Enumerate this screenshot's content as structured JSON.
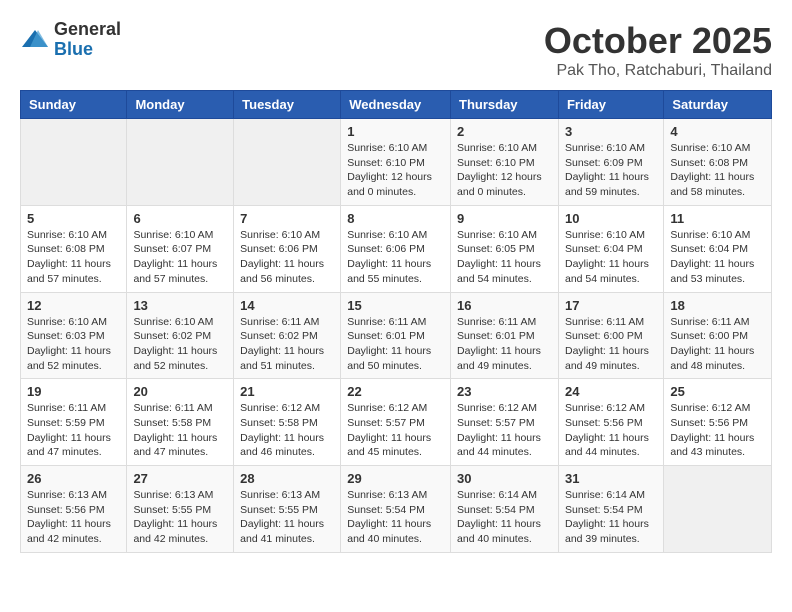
{
  "header": {
    "logo_general": "General",
    "logo_blue": "Blue",
    "month_title": "October 2025",
    "location": "Pak Tho, Ratchaburi, Thailand"
  },
  "weekdays": [
    "Sunday",
    "Monday",
    "Tuesday",
    "Wednesday",
    "Thursday",
    "Friday",
    "Saturday"
  ],
  "weeks": [
    [
      {
        "day": "",
        "info": ""
      },
      {
        "day": "",
        "info": ""
      },
      {
        "day": "",
        "info": ""
      },
      {
        "day": "1",
        "info": "Sunrise: 6:10 AM\nSunset: 6:10 PM\nDaylight: 12 hours\nand 0 minutes."
      },
      {
        "day": "2",
        "info": "Sunrise: 6:10 AM\nSunset: 6:10 PM\nDaylight: 12 hours\nand 0 minutes."
      },
      {
        "day": "3",
        "info": "Sunrise: 6:10 AM\nSunset: 6:09 PM\nDaylight: 11 hours\nand 59 minutes."
      },
      {
        "day": "4",
        "info": "Sunrise: 6:10 AM\nSunset: 6:08 PM\nDaylight: 11 hours\nand 58 minutes."
      }
    ],
    [
      {
        "day": "5",
        "info": "Sunrise: 6:10 AM\nSunset: 6:08 PM\nDaylight: 11 hours\nand 57 minutes."
      },
      {
        "day": "6",
        "info": "Sunrise: 6:10 AM\nSunset: 6:07 PM\nDaylight: 11 hours\nand 57 minutes."
      },
      {
        "day": "7",
        "info": "Sunrise: 6:10 AM\nSunset: 6:06 PM\nDaylight: 11 hours\nand 56 minutes."
      },
      {
        "day": "8",
        "info": "Sunrise: 6:10 AM\nSunset: 6:06 PM\nDaylight: 11 hours\nand 55 minutes."
      },
      {
        "day": "9",
        "info": "Sunrise: 6:10 AM\nSunset: 6:05 PM\nDaylight: 11 hours\nand 54 minutes."
      },
      {
        "day": "10",
        "info": "Sunrise: 6:10 AM\nSunset: 6:04 PM\nDaylight: 11 hours\nand 54 minutes."
      },
      {
        "day": "11",
        "info": "Sunrise: 6:10 AM\nSunset: 6:04 PM\nDaylight: 11 hours\nand 53 minutes."
      }
    ],
    [
      {
        "day": "12",
        "info": "Sunrise: 6:10 AM\nSunset: 6:03 PM\nDaylight: 11 hours\nand 52 minutes."
      },
      {
        "day": "13",
        "info": "Sunrise: 6:10 AM\nSunset: 6:02 PM\nDaylight: 11 hours\nand 52 minutes."
      },
      {
        "day": "14",
        "info": "Sunrise: 6:11 AM\nSunset: 6:02 PM\nDaylight: 11 hours\nand 51 minutes."
      },
      {
        "day": "15",
        "info": "Sunrise: 6:11 AM\nSunset: 6:01 PM\nDaylight: 11 hours\nand 50 minutes."
      },
      {
        "day": "16",
        "info": "Sunrise: 6:11 AM\nSunset: 6:01 PM\nDaylight: 11 hours\nand 49 minutes."
      },
      {
        "day": "17",
        "info": "Sunrise: 6:11 AM\nSunset: 6:00 PM\nDaylight: 11 hours\nand 49 minutes."
      },
      {
        "day": "18",
        "info": "Sunrise: 6:11 AM\nSunset: 6:00 PM\nDaylight: 11 hours\nand 48 minutes."
      }
    ],
    [
      {
        "day": "19",
        "info": "Sunrise: 6:11 AM\nSunset: 5:59 PM\nDaylight: 11 hours\nand 47 minutes."
      },
      {
        "day": "20",
        "info": "Sunrise: 6:11 AM\nSunset: 5:58 PM\nDaylight: 11 hours\nand 47 minutes."
      },
      {
        "day": "21",
        "info": "Sunrise: 6:12 AM\nSunset: 5:58 PM\nDaylight: 11 hours\nand 46 minutes."
      },
      {
        "day": "22",
        "info": "Sunrise: 6:12 AM\nSunset: 5:57 PM\nDaylight: 11 hours\nand 45 minutes."
      },
      {
        "day": "23",
        "info": "Sunrise: 6:12 AM\nSunset: 5:57 PM\nDaylight: 11 hours\nand 44 minutes."
      },
      {
        "day": "24",
        "info": "Sunrise: 6:12 AM\nSunset: 5:56 PM\nDaylight: 11 hours\nand 44 minutes."
      },
      {
        "day": "25",
        "info": "Sunrise: 6:12 AM\nSunset: 5:56 PM\nDaylight: 11 hours\nand 43 minutes."
      }
    ],
    [
      {
        "day": "26",
        "info": "Sunrise: 6:13 AM\nSunset: 5:56 PM\nDaylight: 11 hours\nand 42 minutes."
      },
      {
        "day": "27",
        "info": "Sunrise: 6:13 AM\nSunset: 5:55 PM\nDaylight: 11 hours\nand 42 minutes."
      },
      {
        "day": "28",
        "info": "Sunrise: 6:13 AM\nSunset: 5:55 PM\nDaylight: 11 hours\nand 41 minutes."
      },
      {
        "day": "29",
        "info": "Sunrise: 6:13 AM\nSunset: 5:54 PM\nDaylight: 11 hours\nand 40 minutes."
      },
      {
        "day": "30",
        "info": "Sunrise: 6:14 AM\nSunset: 5:54 PM\nDaylight: 11 hours\nand 40 minutes."
      },
      {
        "day": "31",
        "info": "Sunrise: 6:14 AM\nSunset: 5:54 PM\nDaylight: 11 hours\nand 39 minutes."
      },
      {
        "day": "",
        "info": ""
      }
    ]
  ]
}
